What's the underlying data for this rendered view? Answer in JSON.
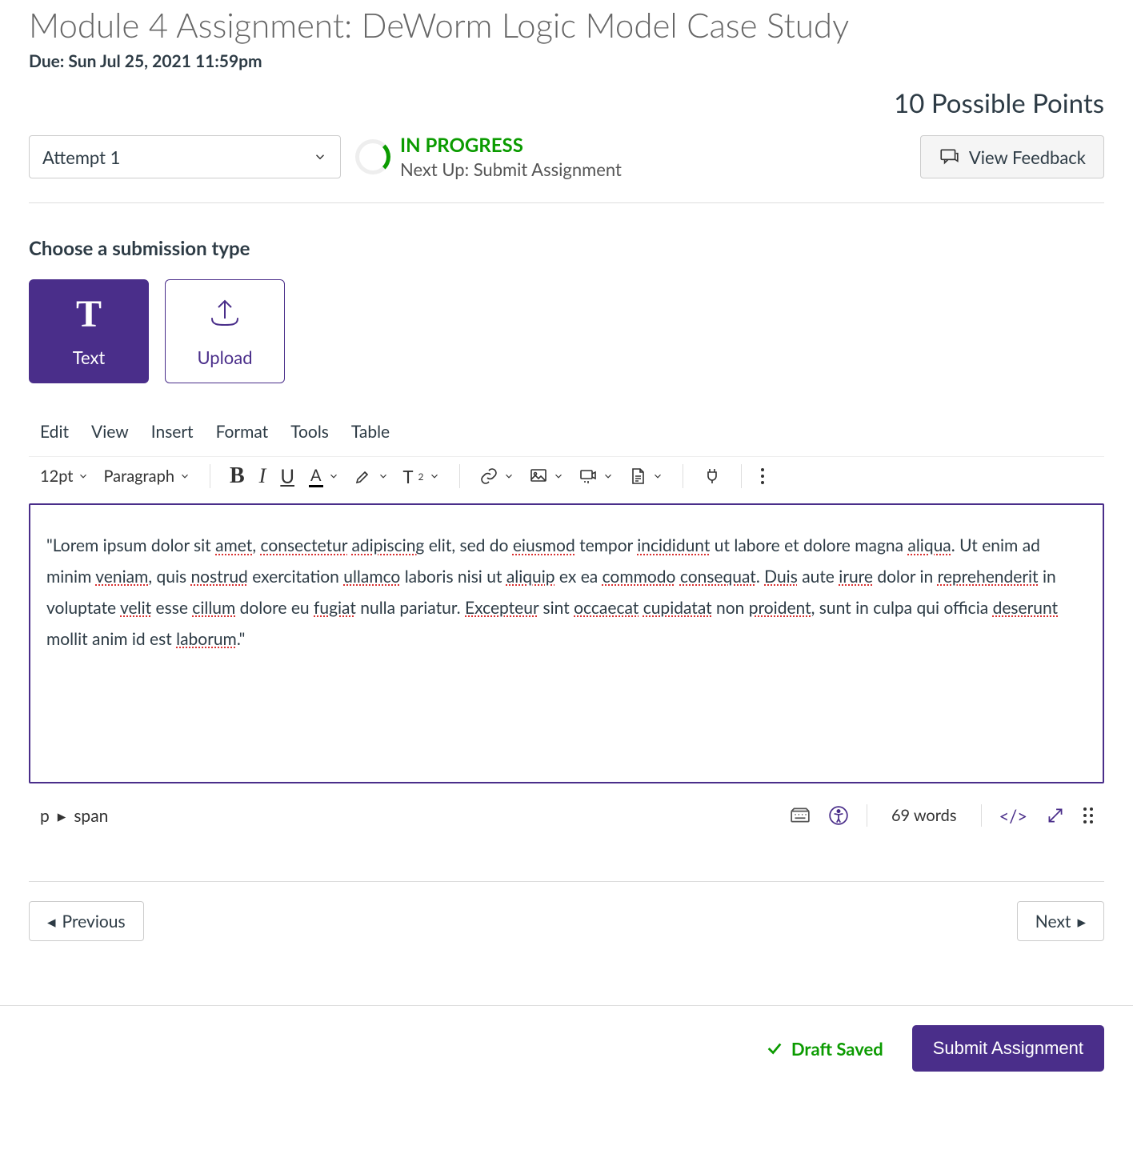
{
  "header": {
    "title": "Module 4 Assignment: DeWorm Logic Model Case Study",
    "due": "Due: Sun Jul 25, 2021 11:59pm",
    "points": "10 Possible Points"
  },
  "status": {
    "attempt": "Attempt 1",
    "in_progress": "IN PROGRESS",
    "next_up": "Next Up: Submit Assignment",
    "feedback_btn": "View Feedback"
  },
  "submission": {
    "heading": "Choose a submission type",
    "text_label": "Text",
    "upload_label": "Upload"
  },
  "editor": {
    "menu": {
      "edit": "Edit",
      "view": "View",
      "insert": "Insert",
      "format": "Format",
      "tools": "Tools",
      "table": "Table"
    },
    "font_size": "12pt",
    "block": "Paragraph",
    "content_parts": [
      {
        "t": "\"Lorem ipsum dolor sit "
      },
      {
        "e": "amet"
      },
      {
        "t": ", "
      },
      {
        "e": "consectetur"
      },
      {
        "t": " "
      },
      {
        "e": "adipiscing"
      },
      {
        "t": " elit, sed do "
      },
      {
        "e": "eiusmod"
      },
      {
        "t": " tempor "
      },
      {
        "e": "incididunt"
      },
      {
        "t": " ut labore et dolore magna "
      },
      {
        "e": "aliqua"
      },
      {
        "t": ". Ut enim ad minim "
      },
      {
        "e": "veniam"
      },
      {
        "t": ", quis "
      },
      {
        "e": "nostrud"
      },
      {
        "t": " exercitation "
      },
      {
        "e": "ullamco"
      },
      {
        "t": " laboris nisi ut "
      },
      {
        "e": "aliquip"
      },
      {
        "t": " ex ea "
      },
      {
        "e": "commodo"
      },
      {
        "t": " "
      },
      {
        "e": "consequat"
      },
      {
        "t": ". "
      },
      {
        "e": "Duis"
      },
      {
        "t": " aute "
      },
      {
        "e": "irure"
      },
      {
        "t": " dolor in "
      },
      {
        "e": "reprehenderit"
      },
      {
        "t": " in voluptate "
      },
      {
        "e": "velit"
      },
      {
        "t": " esse "
      },
      {
        "e": "cillum"
      },
      {
        "t": " dolore eu "
      },
      {
        "e": "fugiat"
      },
      {
        "t": " nulla pariatur. "
      },
      {
        "e": "Excepteur"
      },
      {
        "t": " sint "
      },
      {
        "e": "occaecat"
      },
      {
        "t": " "
      },
      {
        "e": "cupidatat"
      },
      {
        "t": " non "
      },
      {
        "e": "proident"
      },
      {
        "t": ", sunt in culpa qui officia "
      },
      {
        "e": "deserunt"
      },
      {
        "t": " mollit anim id est "
      },
      {
        "e": "laborum"
      },
      {
        "t": ".\""
      }
    ],
    "path_p": "p",
    "path_span": "span",
    "word_count": "69 words"
  },
  "nav": {
    "prev": "Previous",
    "next": "Next"
  },
  "footer": {
    "draft": "Draft Saved",
    "submit": "Submit Assignment"
  }
}
